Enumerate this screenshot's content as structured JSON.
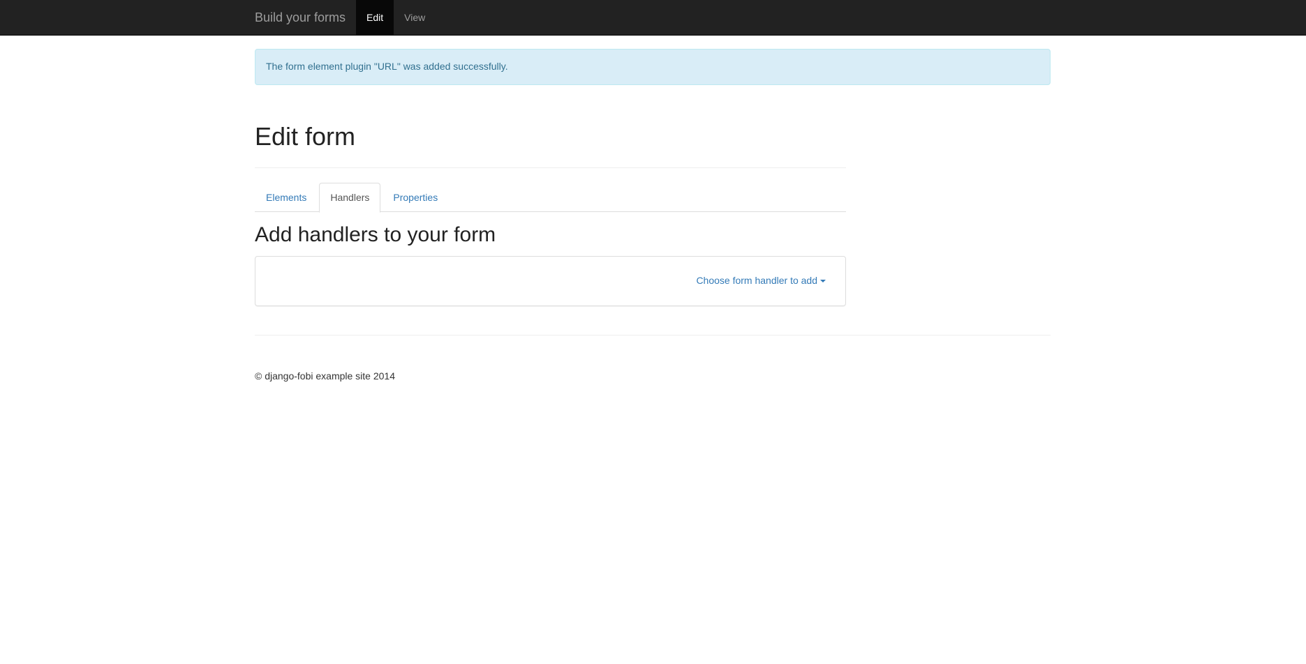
{
  "navbar": {
    "brand": "Build your forms",
    "items": [
      {
        "label": "Edit",
        "active": true
      },
      {
        "label": "View",
        "active": false
      }
    ]
  },
  "alert": {
    "message": "The form element plugin \"URL\" was added successfully.",
    "type": "info"
  },
  "page": {
    "title": "Edit form",
    "tabs": [
      {
        "label": "Elements",
        "active": false
      },
      {
        "label": "Handlers",
        "active": true
      },
      {
        "label": "Properties",
        "active": false
      }
    ],
    "section_title": "Add handlers to your form",
    "dropdown_label": "Choose form handler to add"
  },
  "footer": {
    "text": "© django-fobi example site 2014"
  },
  "colors": {
    "navbar": "#222222",
    "link": "#337ab7",
    "alert_bg": "#d9edf7",
    "alert_text": "#31708f"
  }
}
